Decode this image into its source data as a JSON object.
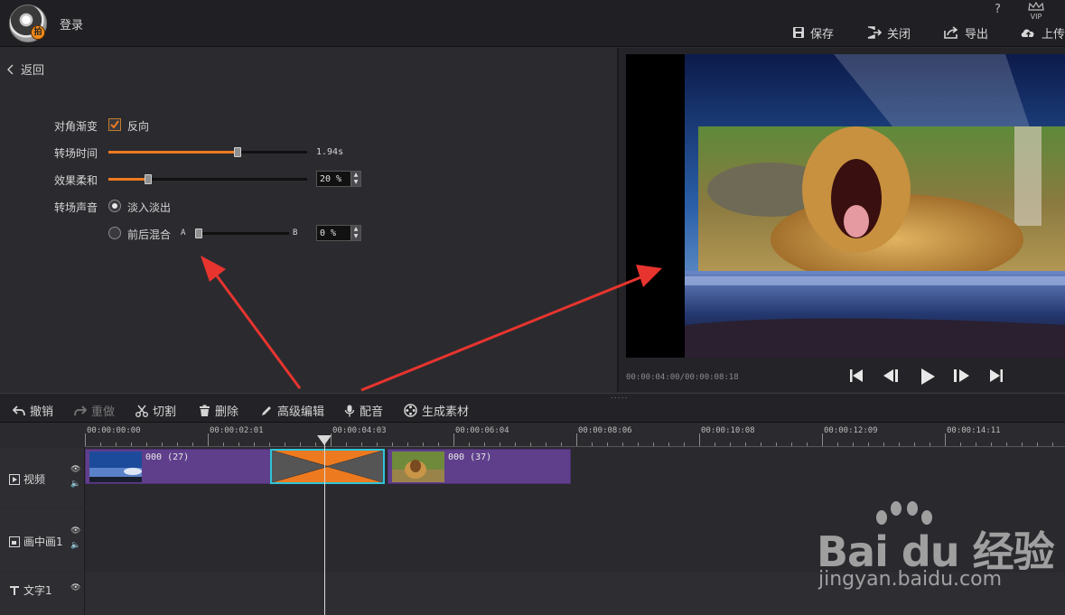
{
  "header": {
    "login_label": "登录",
    "help_label": "?",
    "vip_label": "VIP",
    "buttons": [
      {
        "label": "保存",
        "icon": "save-icon"
      },
      {
        "label": "关闭",
        "icon": "exit-icon"
      },
      {
        "label": "导出",
        "icon": "export-icon"
      },
      {
        "label": "上传",
        "icon": "upload-icon"
      }
    ]
  },
  "left_panel": {
    "back_label": "返回",
    "diagonal_gradient": {
      "label": "对角渐变",
      "checkbox_label": "反向",
      "checked": true
    },
    "transition_time": {
      "label": "转场时间",
      "value_text": "1.94s",
      "level": 0.65
    },
    "softness": {
      "label": "效果柔和",
      "value_text": "20 %",
      "level": 0.2
    },
    "transition_sound": {
      "label": "转场声音",
      "option_fade": {
        "label": "淡入淡出",
        "selected": true
      },
      "option_mix": {
        "label": "前后混合",
        "selected": false,
        "a_label": "A",
        "b_label": "B",
        "value_text": "0 %",
        "level": 0.0
      }
    }
  },
  "preview": {
    "timecode": "00:00:04:00/00:00:08:18",
    "controls": [
      "skip-back-icon",
      "step-back-icon",
      "play-icon",
      "step-forward-icon",
      "skip-forward-icon"
    ]
  },
  "toolbar": {
    "undo": "撤销",
    "redo": "重做",
    "cut": "切割",
    "delete": "删除",
    "advanced": "高级编辑",
    "dub": "配音",
    "generate": "生成素材",
    "grip": "....."
  },
  "timeline": {
    "ruler": [
      "00:00:00:00",
      "00:00:02:01",
      "00:00:04:03",
      "00:00:06:04",
      "00:00:08:06",
      "00:00:10:08",
      "00:00:12:09",
      "00:00:14:11"
    ],
    "tracks": {
      "video": {
        "label": "视频"
      },
      "pip": {
        "label": "画中画1"
      },
      "text": {
        "label": "文字1"
      }
    },
    "clips": [
      {
        "caption": "000 (27)"
      },
      {
        "caption": "000 (37)"
      }
    ]
  },
  "watermark": {
    "brand": "Bai du 经验",
    "url": "jingyan.baidu.com"
  },
  "colors": {
    "accent": "#ee7a1f",
    "clip": "#5f3f8c",
    "transition_border": "#2fc4d8",
    "arrow": "#e8342f"
  }
}
